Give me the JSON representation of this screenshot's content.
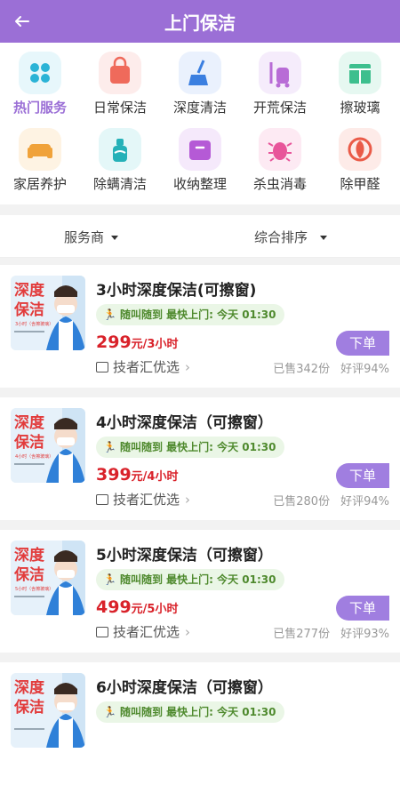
{
  "header": {
    "title": "上门保洁",
    "back_icon": "back-arrow-icon"
  },
  "categories": [
    {
      "label": "热门服务",
      "icon": "grid-icon",
      "color": "#2ab3d6",
      "bg": "#e7f7fb",
      "active": true
    },
    {
      "label": "日常保洁",
      "icon": "bag-icon",
      "color": "#ef6a5b",
      "bg": "#fdeceb"
    },
    {
      "label": "深度清洁",
      "icon": "broom-icon",
      "color": "#3b7fe0",
      "bg": "#eaf1fd"
    },
    {
      "label": "开荒保洁",
      "icon": "vacuum-icon",
      "color": "#b86cd6",
      "bg": "#f5ecfb"
    },
    {
      "label": "擦玻璃",
      "icon": "window-icon",
      "color": "#3dbf8e",
      "bg": "#e6f8f1"
    },
    {
      "label": "家居养护",
      "icon": "sofa-icon",
      "color": "#f0a23a",
      "bg": "#fef3e3"
    },
    {
      "label": "除螨清洁",
      "icon": "spray-icon",
      "color": "#25b1b8",
      "bg": "#e4f7f8"
    },
    {
      "label": "收纳整理",
      "icon": "box-icon",
      "color": "#b55ad6",
      "bg": "#f5e9fb"
    },
    {
      "label": "杀虫消毒",
      "icon": "bug-icon",
      "color": "#e8559a",
      "bg": "#fdeaf3"
    },
    {
      "label": "除甲醛",
      "icon": "leaf-icon",
      "color": "#ea5b48",
      "bg": "#fdebe8"
    }
  ],
  "filters": {
    "provider": "服务商",
    "sort": "综合排序"
  },
  "items": [
    {
      "title": "3小时深度保洁(可擦窗)",
      "tag": "随叫随到 最快上门: 今天 01:30",
      "price": "299",
      "unit": "元/3小时",
      "order": "下单",
      "provider": "技者汇优选",
      "sold": "已售342份",
      "rating": "好评94%",
      "thumb_title": "深度保洁",
      "thumb_sub": "3小时（含擦玻璃）"
    },
    {
      "title": "4小时深度保洁（可擦窗）",
      "tag": "随叫随到 最快上门: 今天 01:30",
      "price": "399",
      "unit": "元/4小时",
      "order": "下单",
      "provider": "技者汇优选",
      "sold": "已售280份",
      "rating": "好评94%",
      "thumb_title": "深度保洁",
      "thumb_sub": "4小时（含擦玻璃）"
    },
    {
      "title": "5小时深度保洁（可擦窗）",
      "tag": "随叫随到 最快上门: 今天 01:30",
      "price": "499",
      "unit": "元/5小时",
      "order": "下单",
      "provider": "技者汇优选",
      "sold": "已售277份",
      "rating": "好评93%",
      "thumb_title": "深度保洁",
      "thumb_sub": "5小时（含擦玻璃）"
    },
    {
      "title": "6小时深度保洁（可擦窗）",
      "tag": "随叫随到 最快上门: 今天 01:30",
      "price": "",
      "unit": "",
      "order": "",
      "provider": "",
      "sold": "",
      "rating": "",
      "thumb_title": "深度保洁",
      "thumb_sub": ""
    }
  ]
}
